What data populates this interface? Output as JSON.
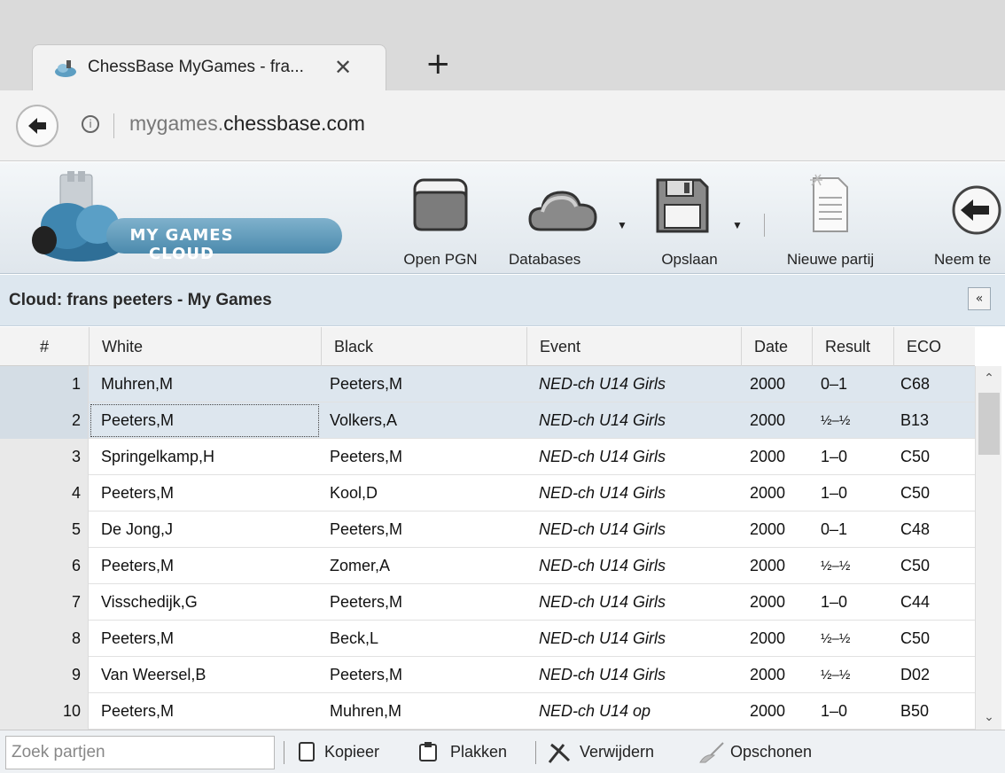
{
  "browser": {
    "tab_title": "ChessBase MyGames - fra...",
    "tab_close": "✕",
    "new_tab": "+",
    "url_host": "mygames.",
    "url_domain": "chessbase.com"
  },
  "toolbar": {
    "logo_text": "MY GAMES CLOUD",
    "buttons": [
      {
        "label": "Open PGN",
        "icon": "folder-icon"
      },
      {
        "label": "Databases",
        "icon": "cloud-icon"
      },
      {
        "label": "Opslaan",
        "icon": "floppy-disk-icon"
      },
      {
        "label": "Nieuwe partij",
        "icon": "new-document-icon"
      },
      {
        "label": "Neem te",
        "icon": "back-arrow-icon"
      }
    ]
  },
  "panel": {
    "title": "Cloud: frans peeters - My Games",
    "collapse_label": "«"
  },
  "table": {
    "columns": [
      "#",
      "White",
      "Black",
      "Event",
      "Date",
      "Result",
      "ECO"
    ],
    "rows": [
      {
        "num": "1",
        "white": "Muhren,M",
        "black": "Peeters,M",
        "event": "NED-ch U14 Girls",
        "date": "2000",
        "result": "0–1",
        "eco": "C68"
      },
      {
        "num": "2",
        "white": "Peeters,M",
        "black": "Volkers,A",
        "event": "NED-ch U14 Girls",
        "date": "2000",
        "result": "½–½",
        "eco": "B13"
      },
      {
        "num": "3",
        "white": "Springelkamp,H",
        "black": "Peeters,M",
        "event": "NED-ch U14 Girls",
        "date": "2000",
        "result": "1–0",
        "eco": "C50"
      },
      {
        "num": "4",
        "white": "Peeters,M",
        "black": "Kool,D",
        "event": "NED-ch U14 Girls",
        "date": "2000",
        "result": "1–0",
        "eco": "C50"
      },
      {
        "num": "5",
        "white": "De Jong,J",
        "black": "Peeters,M",
        "event": "NED-ch U14 Girls",
        "date": "2000",
        "result": "0–1",
        "eco": "C48"
      },
      {
        "num": "6",
        "white": "Peeters,M",
        "black": "Zomer,A",
        "event": "NED-ch U14 Girls",
        "date": "2000",
        "result": "½–½",
        "eco": "C50"
      },
      {
        "num": "7",
        "white": "Visschedijk,G",
        "black": "Peeters,M",
        "event": "NED-ch U14 Girls",
        "date": "2000",
        "result": "1–0",
        "eco": "C44"
      },
      {
        "num": "8",
        "white": "Peeters,M",
        "black": "Beck,L",
        "event": "NED-ch U14 Girls",
        "date": "2000",
        "result": "½–½",
        "eco": "C50"
      },
      {
        "num": "9",
        "white": "Van Weersel,B",
        "black": "Peeters,M",
        "event": "NED-ch U14 Girls",
        "date": "2000",
        "result": "½–½",
        "eco": "D02"
      },
      {
        "num": "10",
        "white": "Peeters,M",
        "black": "Muhren,M",
        "event": "NED-ch U14 op",
        "date": "2000",
        "result": "1–0",
        "eco": "B50"
      }
    ]
  },
  "bottom": {
    "search_placeholder": "Zoek partjen",
    "copy_label": "Kopieer",
    "paste_label": "Plakken",
    "delete_label": "Verwijdern",
    "clean_label": "Opschonen"
  },
  "colors": {
    "selected_row": "#dde6ee",
    "logo_blue": "#4b8aad",
    "panel_header": "#dde7ef"
  }
}
